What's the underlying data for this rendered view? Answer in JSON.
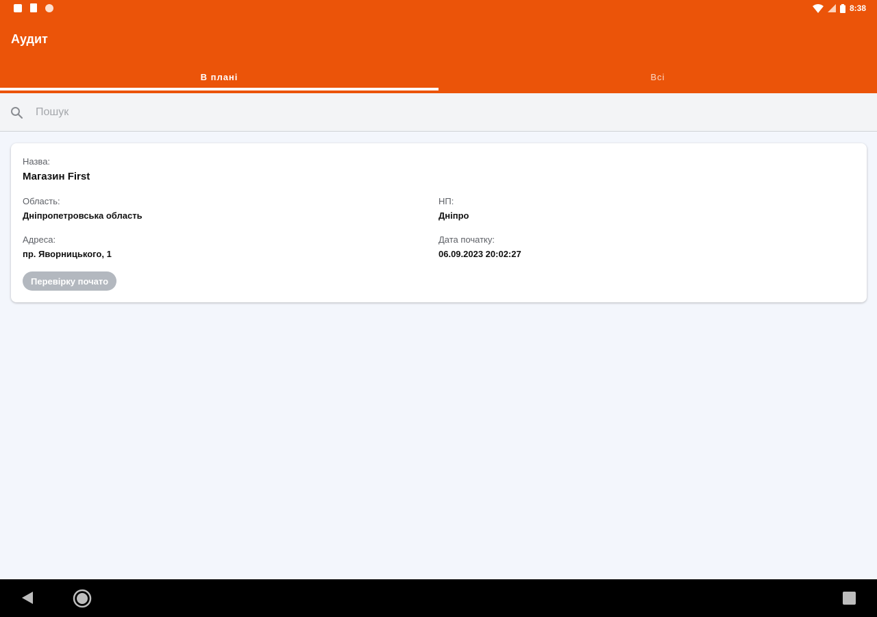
{
  "status_bar": {
    "time": "8:38",
    "icons": [
      "notification-icon",
      "sd-card-icon",
      "shield-icon",
      "wifi-icon",
      "signal-icon",
      "battery-icon"
    ]
  },
  "app_bar": {
    "title": "Аудит",
    "color": "#eb5409"
  },
  "tabs": [
    {
      "label": "В плані",
      "selected": true
    },
    {
      "label": "Всі",
      "selected": false
    }
  ],
  "search": {
    "placeholder": "Пошук",
    "value": ""
  },
  "card": {
    "name_label": "Назва:",
    "name_value": "Магазин First",
    "region_label": "Область:",
    "region_value": "Дніпропетровська область",
    "city_label": "НП:",
    "city_value": "Дніпро",
    "address_label": "Адреса:",
    "address_value": "пр. Яворницького, 1",
    "start_date_label": "Дата початку:",
    "start_date_value": "06.09.2023 20:02:27",
    "status_badge": "Перевірку почато"
  },
  "nav_bar": {
    "icons": [
      "back-icon",
      "home-icon",
      "recent-apps-icon"
    ]
  }
}
